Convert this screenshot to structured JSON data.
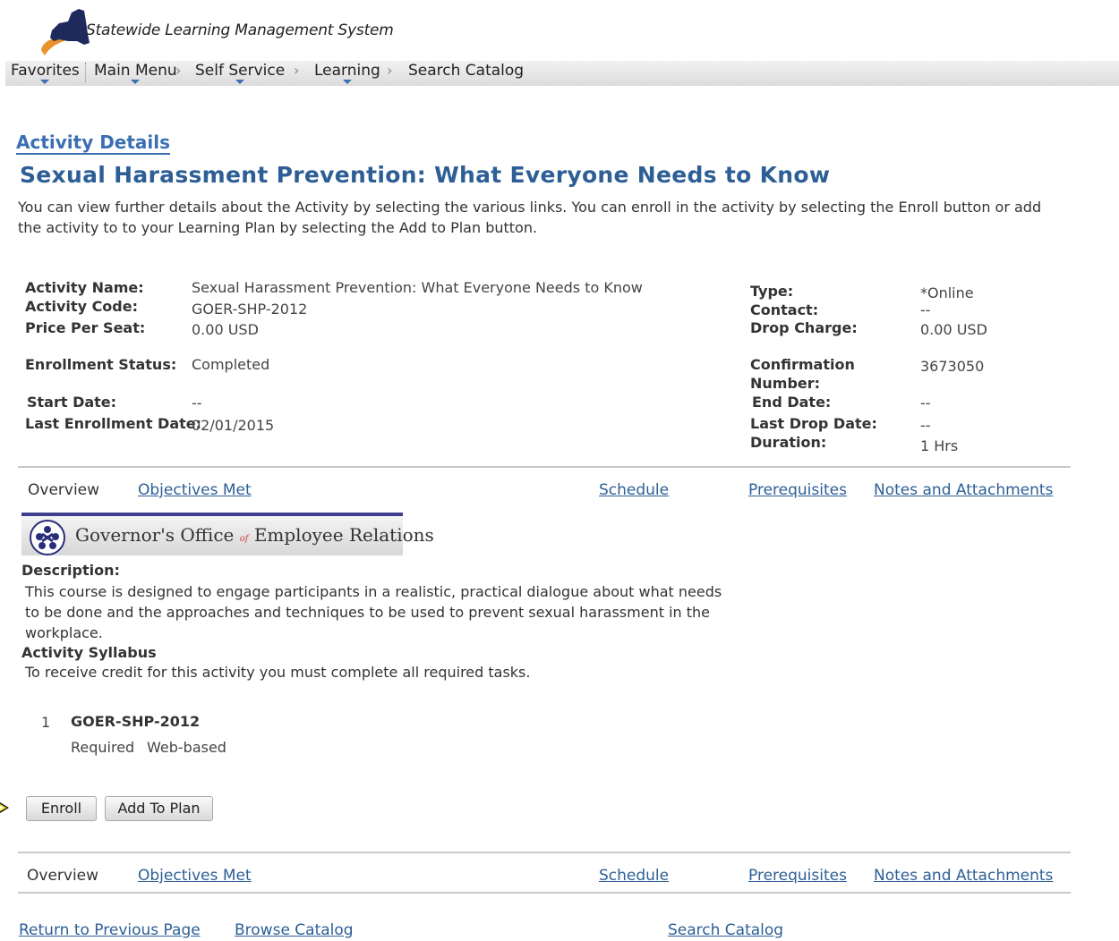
{
  "header": {
    "site_title": "Statewide Learning Management System"
  },
  "nav": {
    "favorites": "Favorites",
    "main_menu": "Main Menu",
    "self_service": "Self Service",
    "learning": "Learning",
    "search_catalog": "Search Catalog",
    "separator": "›"
  },
  "page": {
    "label": "Activity Details",
    "title": "Sexual Harassment Prevention: What Everyone Needs to Know",
    "intro": "You can view further details about the Activity by selecting the various links. You can enroll in the activity by selecting the Enroll button or add the activity to to your Learning Plan by selecting the Add to Plan button."
  },
  "details": {
    "activity_name_label": "Activity Name:",
    "activity_name": "Sexual Harassment Prevention: What Everyone Needs to Know",
    "activity_code_label": "Activity Code:",
    "activity_code": "GOER-SHP-2012",
    "price_label": "Price Per Seat:",
    "price": "0.00 USD",
    "enrollment_status_label": "Enrollment Status:",
    "enrollment_status": "Completed",
    "start_date_label": "Start Date:",
    "start_date": "--",
    "last_enroll_label": "Last Enrollment Date:",
    "last_enroll": "02/01/2015",
    "type_label": "Type:",
    "type": "*Online",
    "contact_label": "Contact:",
    "contact": "--",
    "drop_charge_label": "Drop Charge:",
    "drop_charge": "0.00 USD",
    "confirmation_label_1": "Confirmation",
    "confirmation_label_2": "Number:",
    "confirmation": "3673050",
    "end_date_label": "End Date:",
    "end_date": "--",
    "last_drop_label": "Last Drop Date:",
    "last_drop": "--",
    "duration_label": "Duration:",
    "duration": "1 Hrs"
  },
  "tabs": {
    "overview": "Overview",
    "objectives": "Objectives Met",
    "schedule": "Schedule",
    "prerequisites": "Prerequisites",
    "notes": "Notes and Attachments"
  },
  "banner": {
    "part1": "Governor's Office",
    "part2": "of",
    "part3": "Employee Relations"
  },
  "overview": {
    "description_label": "Description:",
    "description": "This course is designed to engage participants in a realistic, practical dialogue about what needs to be done and the approaches and techniques to be used to prevent sexual harassment in the workplace.",
    "syllabus_label": "Activity Syllabus",
    "syllabus_note": "To receive credit for this activity you must complete all required tasks.",
    "task_number": "1",
    "task_code": "GOER-SHP-2012",
    "task_required": "Required",
    "task_type": "Web-based"
  },
  "buttons": {
    "enroll": "Enroll",
    "add_to_plan": "Add To Plan"
  },
  "footer": {
    "return": "Return to Previous Page",
    "browse": "Browse Catalog",
    "search": "Search Catalog"
  },
  "colors": {
    "link": "#2d5f96",
    "title": "#2d5f96",
    "banner_bar": "#3d3f8e"
  }
}
